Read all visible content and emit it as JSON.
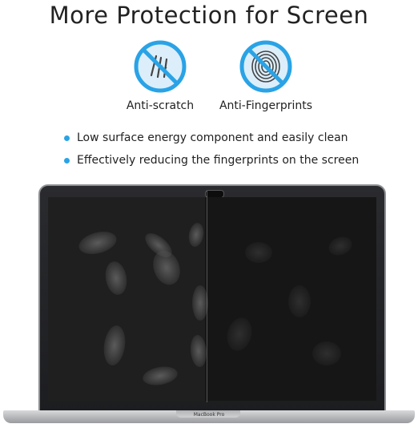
{
  "title": "More Protection for Screen",
  "features": [
    {
      "label": "Anti-scratch",
      "icon": "anti-scratch-icon"
    },
    {
      "label": "Anti-Fingerprints",
      "icon": "anti-fingerprint-icon"
    }
  ],
  "bullets": [
    "Low surface energy component and easily clean",
    "Effectively reducing the fingerprints on the screen"
  ],
  "laptop": {
    "model_label": "MacBook Pro"
  },
  "colors": {
    "accent": "#2aa3e6",
    "icon_bg": "#dceefa"
  }
}
